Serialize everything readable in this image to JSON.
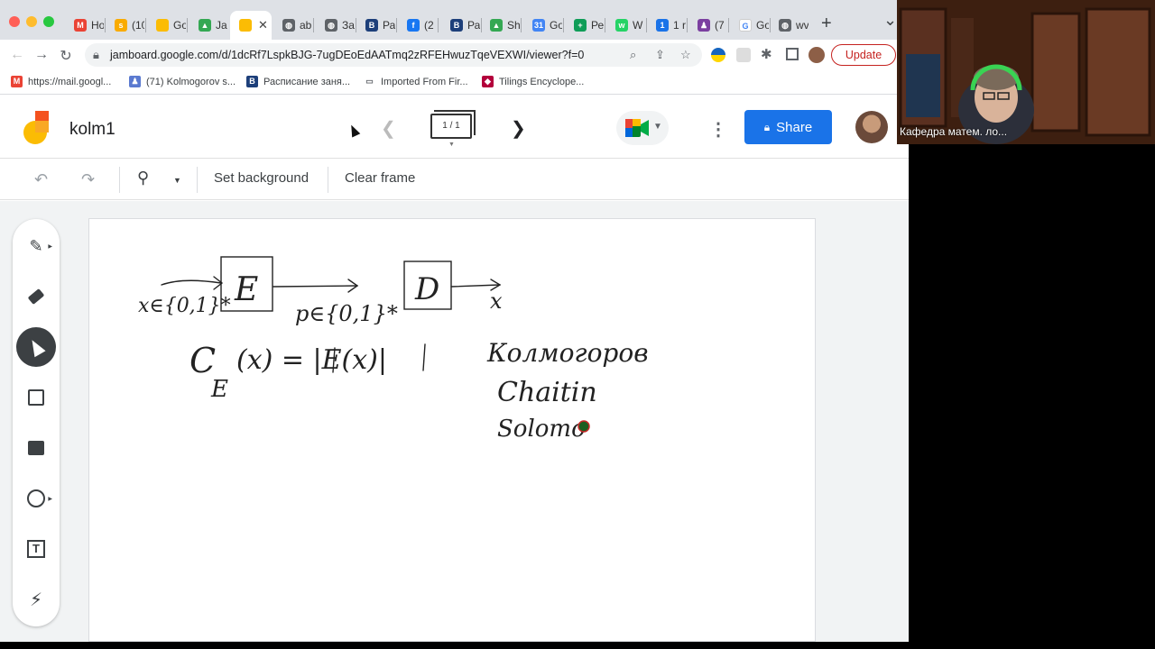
{
  "browser": {
    "tabs": [
      {
        "label": "Ho",
        "fav_color": "#ea4335",
        "fav_char": "M"
      },
      {
        "label": "(10",
        "fav_color": "#f9ab00",
        "fav_char": "s"
      },
      {
        "label": "Go",
        "fav_color": "#fbbc04",
        "fav_char": ""
      },
      {
        "label": "Ja",
        "fav_color": "#34a853",
        "fav_char": "▲"
      },
      {
        "label": "",
        "fav_color": "#fbbc04",
        "fav_char": ""
      },
      {
        "label": "ab",
        "fav_color": "#5f6368",
        "fav_char": "◍"
      },
      {
        "label": "За",
        "fav_color": "#5f6368",
        "fav_char": "◍"
      },
      {
        "label": "Ра",
        "fav_color": "#1d3f7a",
        "fav_char": "B"
      },
      {
        "label": "(2",
        "fav_color": "#1877f2",
        "fav_char": "f"
      },
      {
        "label": "Ра",
        "fav_color": "#1d3f7a",
        "fav_char": "B"
      },
      {
        "label": "Sh",
        "fav_color": "#34a853",
        "fav_char": "▲"
      },
      {
        "label": "Go",
        "fav_color": "#4285f4",
        "fav_char": "31"
      },
      {
        "label": "Ре",
        "fav_color": "#0f9d58",
        "fav_char": "+"
      },
      {
        "label": "W",
        "fav_color": "#25d366",
        "fav_char": "w"
      },
      {
        "label": "1 r",
        "fav_color": "#1a73e8",
        "fav_char": "1"
      },
      {
        "label": "(7",
        "fav_color": "#7b3fa0",
        "fav_char": "♟"
      },
      {
        "label": "Go",
        "fav_color": "#ffffff",
        "fav_char": "G"
      },
      {
        "label": "wv",
        "fav_color": "#5f6368",
        "fav_char": "◍"
      }
    ],
    "new_tab": "+",
    "tab_menu": "⌄",
    "url": "jamboard.google.com/d/1dcRf7LspkBJG-7ugDEoEdAATmq2zRFEHwuzTqeVEXWI/viewer?f=0",
    "update_label": "Update",
    "bookmarks": [
      {
        "label": "https://mail.googl...",
        "ico_color": "#ea4335",
        "ico_char": "M"
      },
      {
        "label": "(71) Kolmogorov s...",
        "ico_color": "#5b7ad0",
        "ico_char": "♟"
      },
      {
        "label": "Расписание заня...",
        "ico_color": "#1d3f7a",
        "ico_char": "B"
      },
      {
        "label": "Imported From Fir...",
        "ico_color": "#ffffff",
        "ico_char": "▭"
      },
      {
        "label": "Tilings Encyclope...",
        "ico_color": "#b3003b",
        "ico_char": "◆"
      }
    ]
  },
  "app": {
    "title": "kolm1",
    "frame_counter": "1 / 1",
    "share_label": "Share",
    "toolbar": {
      "set_background": "Set background",
      "clear_frame": "Clear frame"
    }
  },
  "tools": [
    {
      "name": "pen-tool",
      "icon": "pen-icon"
    },
    {
      "name": "eraser-tool",
      "icon": "eraser-icon"
    },
    {
      "name": "select-tool",
      "icon": "cursor-icon",
      "selected": true
    },
    {
      "name": "sticky-note-tool",
      "icon": "sticky-note-icon"
    },
    {
      "name": "add-image-tool",
      "icon": "image-icon"
    },
    {
      "name": "circle-tool",
      "icon": "circle-icon"
    },
    {
      "name": "text-box-tool",
      "icon": "text-box-icon"
    },
    {
      "name": "laser-tool",
      "icon": "laser-icon"
    }
  ],
  "canvas_text": {
    "input_label": "x∈{0,1}*",
    "encoder": "E",
    "code_label": "p∈{0,1}*",
    "decoder": "D",
    "output_label": "x",
    "formula_left": "C",
    "formula_sub": "E",
    "formula_right": "(x) = |E(x)|",
    "name1": "Колмогоров",
    "name2": "Chaitin",
    "name3": "Solomo"
  },
  "webcam": {
    "label": "Кафедра матем. ло..."
  }
}
